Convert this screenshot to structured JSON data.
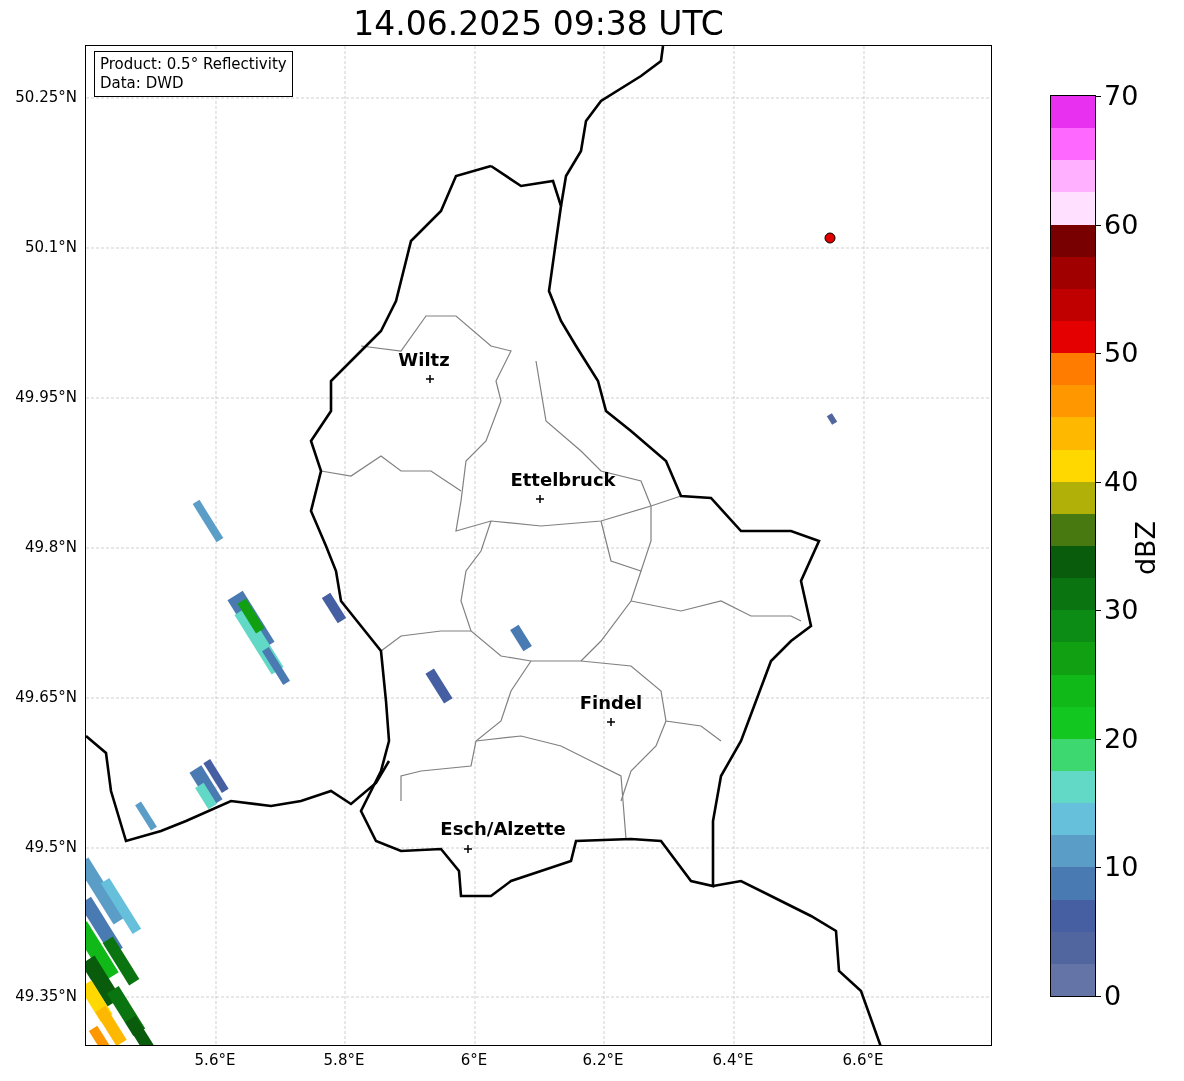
{
  "title": "14.06.2025 09:38 UTC",
  "info_box": [
    "Product: 0.5° Reflectivity",
    "Data: DWD"
  ],
  "cities": [
    {
      "name": "Wiltz"
    },
    {
      "name": "Ettelbruck"
    },
    {
      "name": "Findel"
    },
    {
      "name": "Esch/Alzette"
    }
  ],
  "x_ticks": [
    "5.6°E",
    "5.8°E",
    "6°E",
    "6.2°E",
    "6.4°E",
    "6.6°E"
  ],
  "y_ticks": [
    "50.25°N",
    "50.1°N",
    "49.95°N",
    "49.8°N",
    "49.65°N",
    "49.5°N",
    "49.35°N"
  ],
  "colorbar": {
    "label": "dBZ",
    "ticks": [
      "70",
      "60",
      "50",
      "40",
      "30",
      "20",
      "10",
      "0"
    ],
    "bins": [
      {
        "color": "#6474a6"
      },
      {
        "color": "#51669f"
      },
      {
        "color": "#455fa2"
      },
      {
        "color": "#4a7ab2"
      },
      {
        "color": "#5a9ec8"
      },
      {
        "color": "#66c0dc"
      },
      {
        "color": "#62d8c6"
      },
      {
        "color": "#3ed870"
      },
      {
        "color": "#12c820"
      },
      {
        "color": "#10b818"
      },
      {
        "color": "#10a012"
      },
      {
        "color": "#0c8c14"
      },
      {
        "color": "#0a7410"
      },
      {
        "color": "#085c0c"
      },
      {
        "color": "#487810"
      },
      {
        "color": "#b0b008"
      },
      {
        "color": "#ffd800"
      },
      {
        "color": "#ffb800"
      },
      {
        "color": "#ff9800"
      },
      {
        "color": "#ff7c00"
      },
      {
        "color": "#e40000"
      },
      {
        "color": "#c00000"
      },
      {
        "color": "#a00000"
      },
      {
        "color": "#780000"
      },
      {
        "color": "#ffe0ff"
      },
      {
        "color": "#ffb0ff"
      },
      {
        "color": "#ff68ff"
      },
      {
        "color": "#e830f0"
      }
    ]
  }
}
